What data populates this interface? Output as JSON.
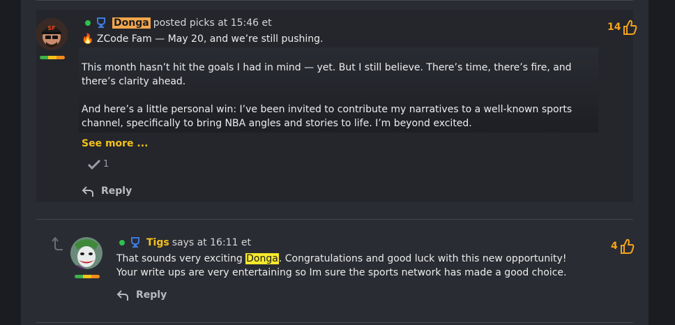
{
  "post": {
    "username": "Donga",
    "meta_text": "posted picks at 15:46 et",
    "first_line_emoji": "🔥",
    "first_line": "ZCode Fam — May 20, and we’re still pushing.",
    "paragraph_1": "This month hasn’t hit the goals I had in mind — yet. But I still believe. There’s time, there’s fire, and there’s clarity ahead.",
    "paragraph_2": "And here’s a little personal win: I’ve been invited to contribute my narratives to a well-known sports channel, specifically to bring NBA angles and stories to life. I’m beyond excited.",
    "see_more": "See more ...",
    "confirm_count": "1",
    "reply_label": "Reply",
    "likes": "14"
  },
  "comment": {
    "username": "Tigs",
    "meta_text": "says at 16:11 et",
    "text_before": "That sounds very exciting ",
    "mention": "Donga",
    "text_after": ". Congratulations and good luck with this new opportunity!",
    "line_2": "Your write ups are very entertaining so Im sure the sports network has made a good choice.",
    "reply_label": "Reply",
    "likes": "4"
  },
  "colors": {
    "accent_orange": "#f4a41c",
    "highlight_yellow": "#f7e92c",
    "username_highlight": "#f2a64b",
    "online_green": "#2fc04e",
    "badge_blue": "#3d7be0"
  },
  "icons": {
    "badge": "trophy-badge-icon",
    "like": "thumbs-up-icon",
    "reply": "reply-arrow-icon",
    "confirm": "checkmark-icon",
    "thread": "thread-up-arrow-icon"
  }
}
